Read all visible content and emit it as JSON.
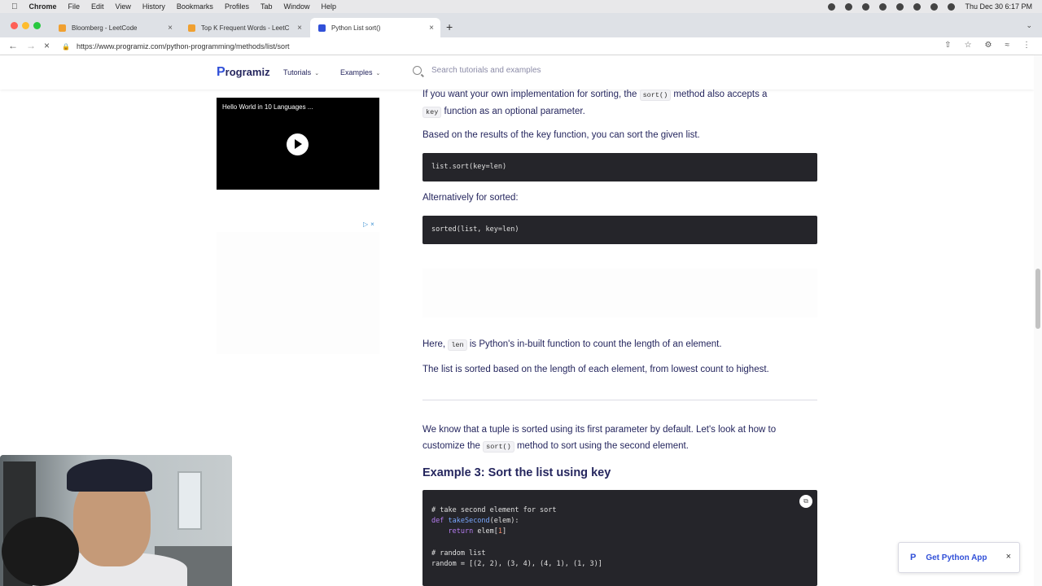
{
  "mac": {
    "menus": [
      "Chrome",
      "File",
      "Edit",
      "View",
      "History",
      "Bookmarks",
      "Profiles",
      "Tab",
      "Window",
      "Help"
    ],
    "datetime": "Thu Dec 30  6:17 PM"
  },
  "browser": {
    "tabs": [
      {
        "title": "Bloomberg - LeetCode",
        "active": false
      },
      {
        "title": "Top K Frequent Words - LeetC",
        "active": false
      },
      {
        "title": "Python List sort()",
        "active": true
      }
    ],
    "url": "https://www.programiz.com/python-programming/methods/list/sort"
  },
  "site": {
    "logo": "rogramiz",
    "logo_letter": "P",
    "nav": [
      "Tutorials",
      "Examples"
    ],
    "search_placeholder": "Search tutorials and examples"
  },
  "sidebar": {
    "video_title": "Hello World in 10 Languages ..."
  },
  "article": {
    "p1_a": "If you want your own implementation for sorting, the ",
    "p1_code1": "sort()",
    "p1_b": " method also accepts a",
    "p1_code2": "key",
    "p1_c": " function as an optional parameter.",
    "p2": "Based on the results of the key function, you can sort the given list.",
    "code1": "list.sort(key=len)",
    "p3": "Alternatively for sorted:",
    "code2": "sorted(list, key=len)",
    "p4_a": "Here, ",
    "p4_code": "len",
    "p4_b": " is Python's in-built function to count the length of an element.",
    "p5": "The list is sorted based on the length of each element, from lowest count to highest.",
    "p6_a": "We know that a tuple is sorted using its first parameter by default. Let's look at how to",
    "p6_b": "customize the ",
    "p6_code": "sort()",
    "p6_c": " method to sort using the second element.",
    "example_heading": "Example 3: Sort the list using key",
    "example_code": {
      "comment1": "# take second element for sort",
      "def_kw": "def",
      "def_fn": "takeSecond",
      "def_rest": "(elem):",
      "ret_kw": "return",
      "ret_rest": " elem[",
      "ret_idx": "1",
      "ret_close": "]",
      "comment2": "# random list",
      "random_line": "random = [(2, 2), (3, 4), (4, 1), (1, 3)]"
    }
  },
  "getapp": {
    "label": "Get Python App"
  },
  "colors": {
    "brand": "#3150d8",
    "text": "#25265e",
    "code_bg": "#25252a"
  }
}
